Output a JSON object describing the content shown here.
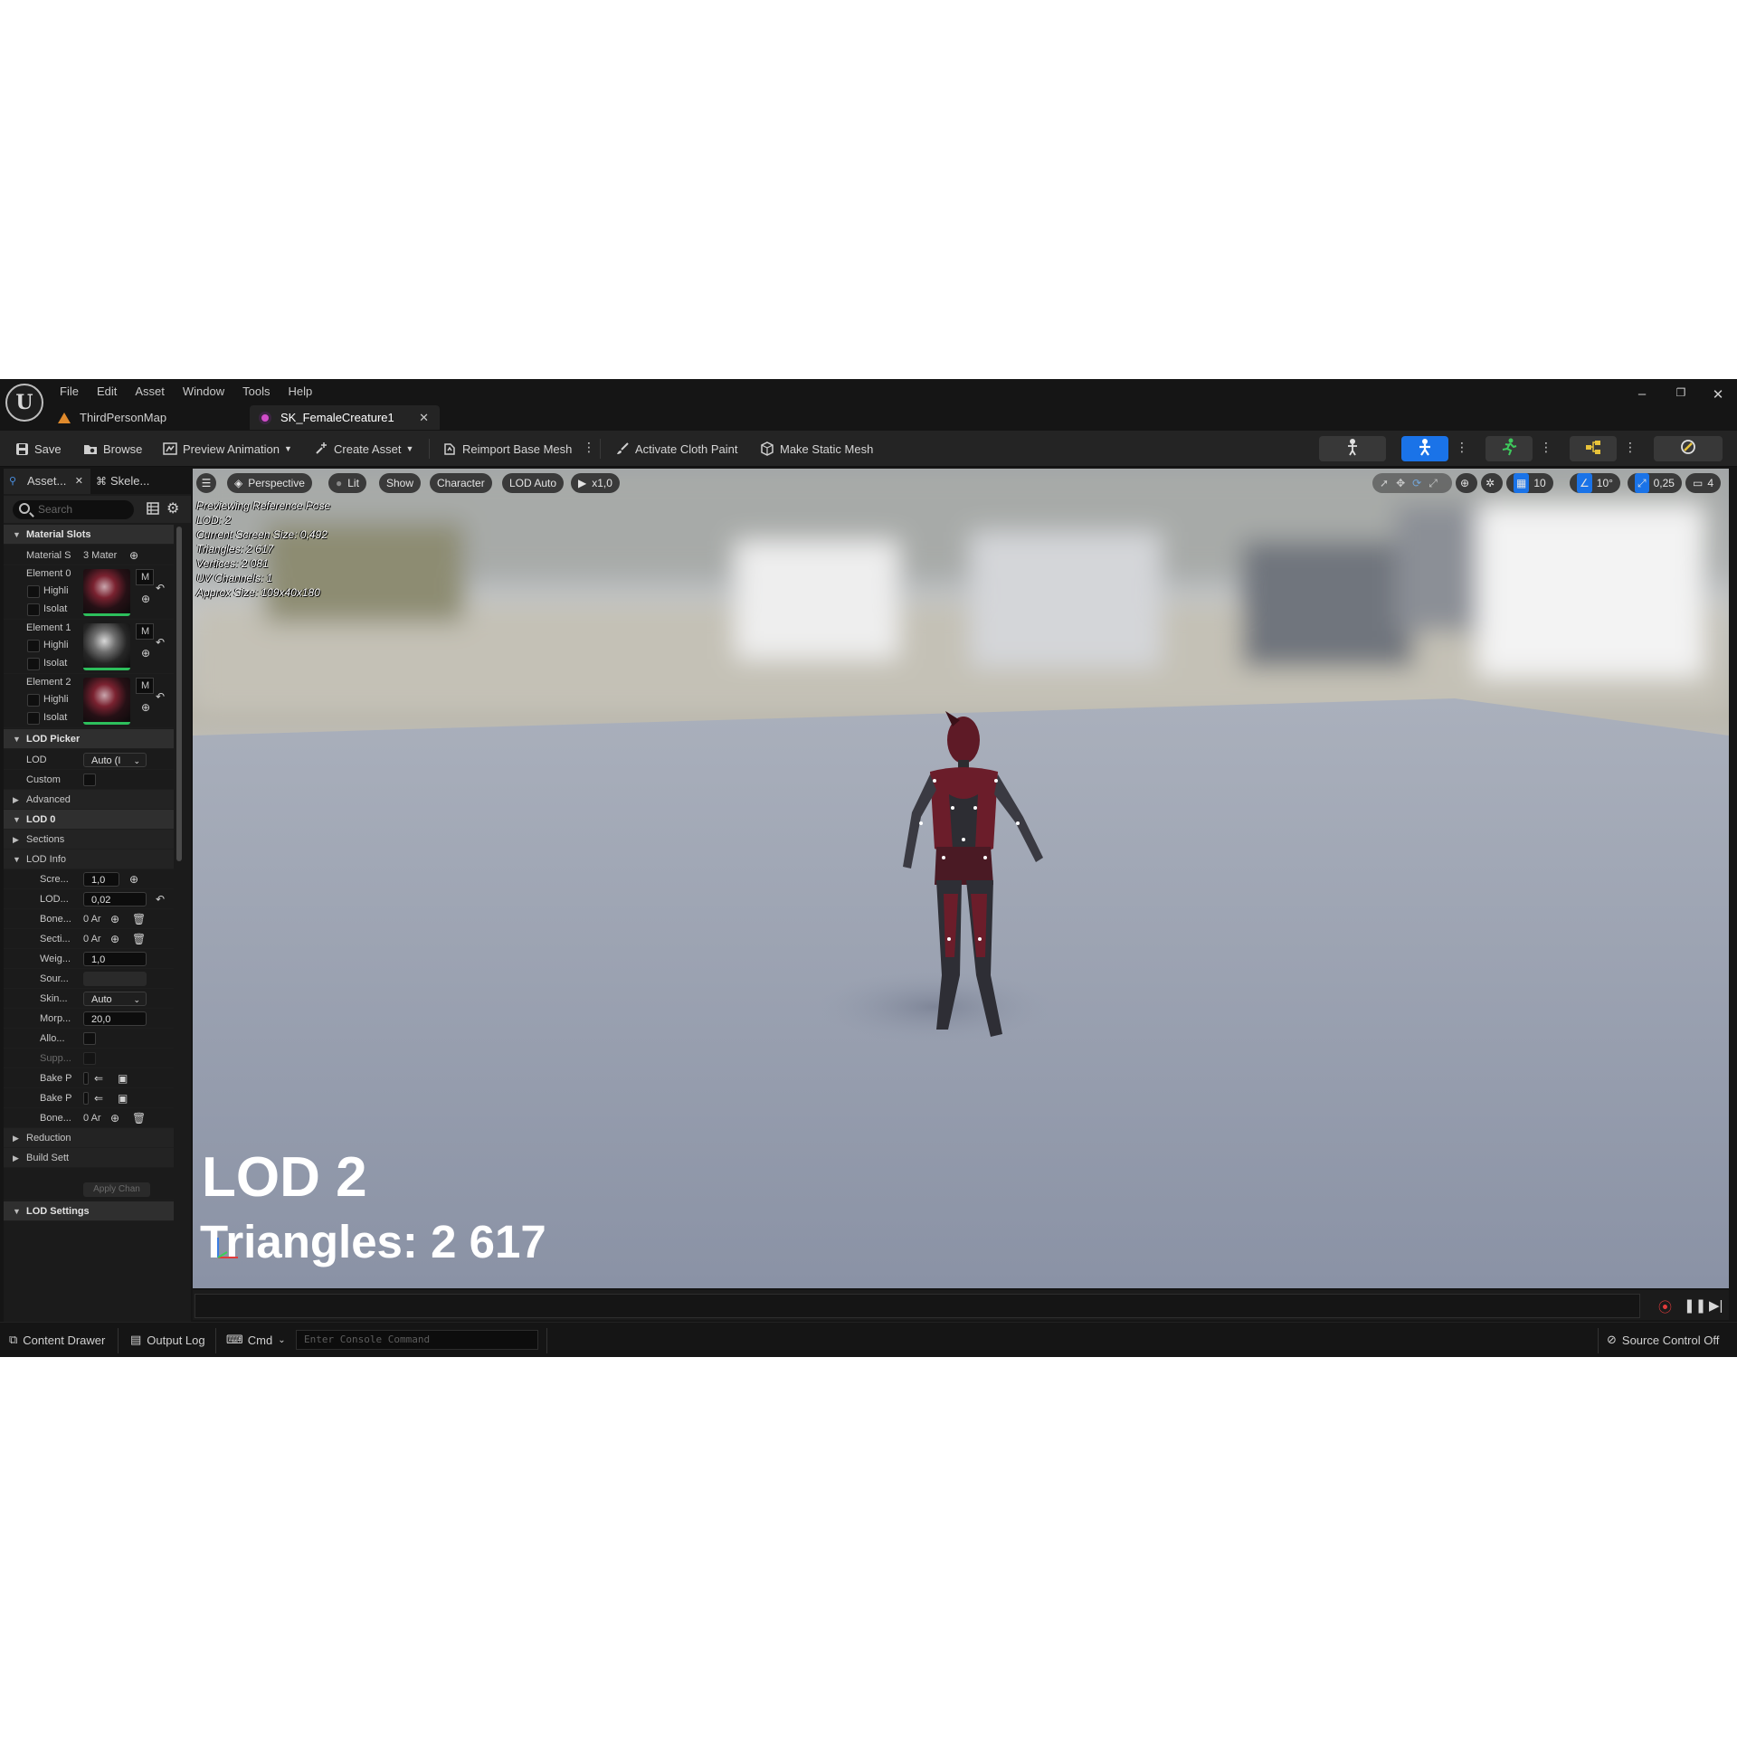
{
  "menu": [
    "File",
    "Edit",
    "Asset",
    "Window",
    "Tools",
    "Help"
  ],
  "tabs": {
    "map": "ThirdPersonMap",
    "mesh": "SK_FemaleCreature1"
  },
  "toolbar": {
    "save": "Save",
    "browse": "Browse",
    "preview_animation": "Preview Animation",
    "create_asset": "Create Asset",
    "reimport": "Reimport Base Mesh",
    "cloth_paint": "Activate Cloth Paint",
    "make_static": "Make Static Mesh"
  },
  "left_panel": {
    "tab_asset": "Asset...",
    "tab_skeleton": "Skele...",
    "search_placeholder": "Search",
    "material_slots": "Material Slots",
    "material_label": "Material S",
    "material_value": "3 Materi",
    "element0": "Element 0",
    "element1": "Element 1",
    "element2": "Element 2",
    "highlight": "Highli",
    "isolate": "Isolat",
    "m": "M",
    "lod_picker": "LOD Picker",
    "lod": "LOD",
    "lod_value": "Auto (I",
    "custom": "Custom",
    "advanced": "Advanced",
    "lod0": "LOD 0",
    "sections": "Sections",
    "lod_info": "LOD Info",
    "screen": "Scre...",
    "screen_val": "1,0",
    "lodh": "LOD...",
    "lodh_val": "0,02",
    "bone": "Bone...",
    "bone_val": "0 Ar",
    "section": "Secti...",
    "section_val": "0 Ar",
    "weight": "Weig...",
    "weight_val": "1,0",
    "source": "Sour...",
    "skin": "Skin...",
    "skin_val": "Auto",
    "morph": "Morp...",
    "morph_val": "20,0",
    "allow": "Allo...",
    "supp": "Supp...",
    "bake1": "Bake P",
    "bake2": "Bake P",
    "bone2": "Bone...",
    "bone2_val": "0 Ar",
    "reduction": "Reduction",
    "build": "Build Sett",
    "apply": "Apply Chan",
    "lod_settings": "LOD Settings"
  },
  "viewport": {
    "perspective": "Perspective",
    "lit": "Lit",
    "show": "Show",
    "character": "Character",
    "lod_auto": "LOD Auto",
    "speed": "x1,0",
    "grid": "10",
    "angle": "10°",
    "scale": "0,25",
    "camera": "4",
    "stats": [
      "Previewing Reference Pose",
      "LOD: 2",
      "Current Screen Size: 0,492",
      "Triangles: 2 617",
      "Vertices: 2 081",
      "UV Channels: 1",
      "Approx Size: 109x40x180"
    ],
    "lod_overlay": "LOD 2",
    "triangles_overlay": "Triangles: 2 617"
  },
  "statusbar": {
    "content_drawer": "Content Drawer",
    "output_log": "Output Log",
    "cmd": "Cmd",
    "console_placeholder": "Enter Console Command",
    "source_control": "Source Control Off"
  },
  "colors": {
    "accent": "#1a73e8",
    "panel": "#1b1b1b",
    "floor": "#a5aab5"
  }
}
